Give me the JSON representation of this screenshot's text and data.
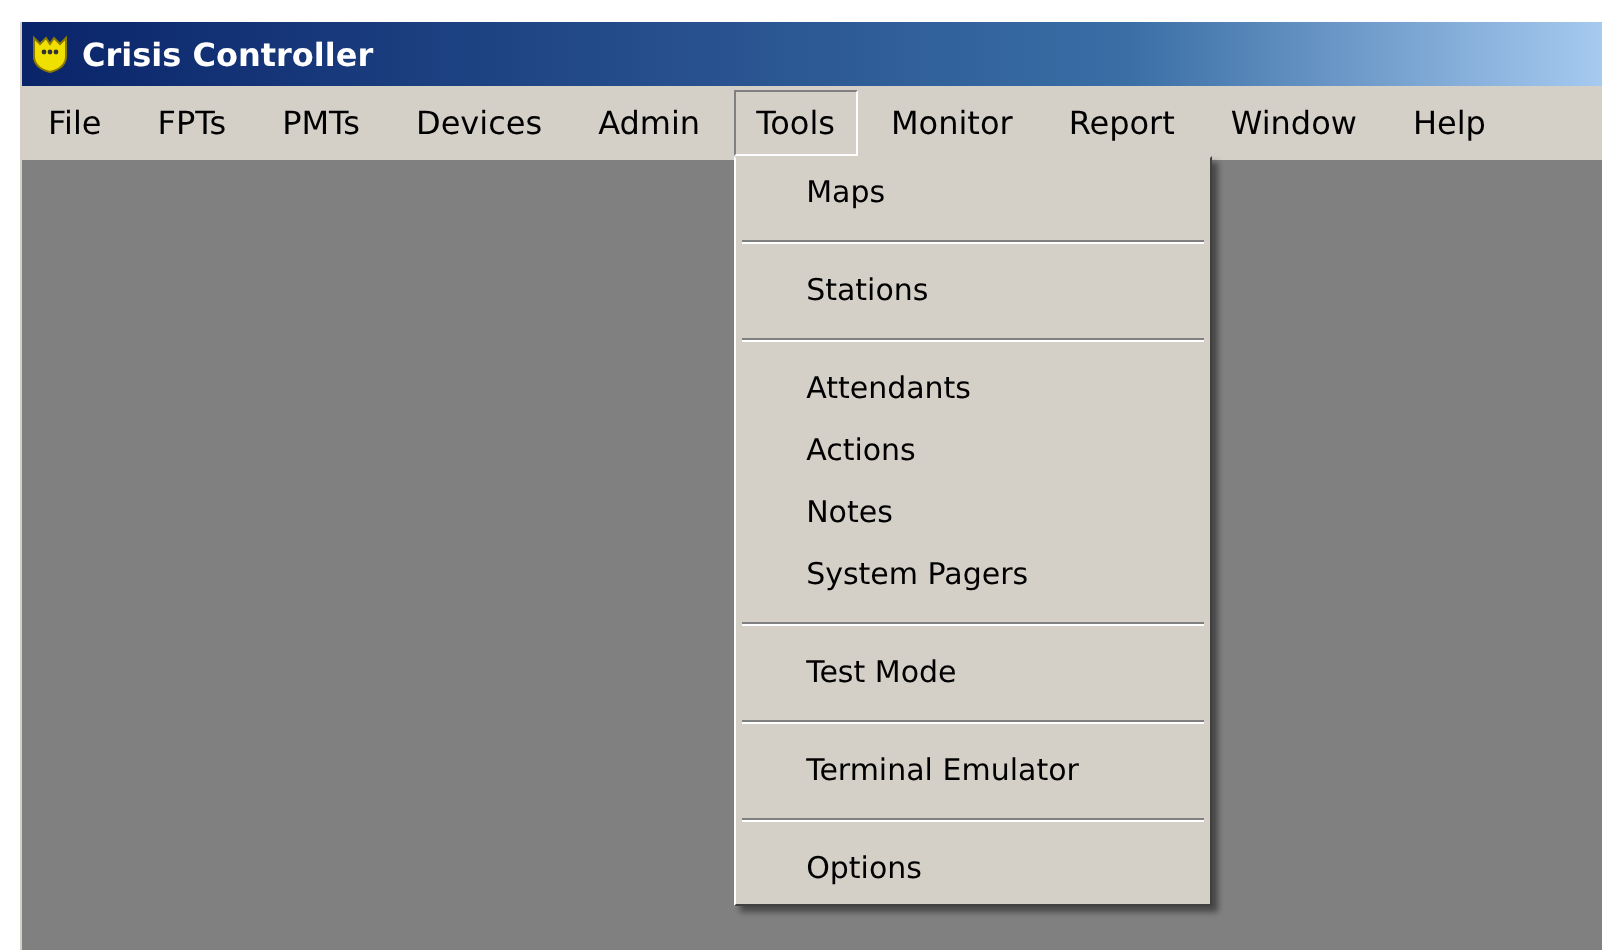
{
  "window": {
    "title": "Crisis Controller"
  },
  "menu_bar": [
    {
      "label": "File",
      "selected": false
    },
    {
      "label": "FPTs",
      "selected": false
    },
    {
      "label": "PMTs",
      "selected": false
    },
    {
      "label": "Devices",
      "selected": false
    },
    {
      "label": "Admin",
      "selected": false
    },
    {
      "label": "Tools",
      "selected": true
    },
    {
      "label": "Monitor",
      "selected": false
    },
    {
      "label": "Report",
      "selected": false
    },
    {
      "label": "Window",
      "selected": false
    },
    {
      "label": "Help",
      "selected": false
    }
  ],
  "dropdown": {
    "items": [
      {
        "kind": "item",
        "label": "Maps"
      },
      {
        "kind": "separator"
      },
      {
        "kind": "item",
        "label": "Stations"
      },
      {
        "kind": "separator"
      },
      {
        "kind": "item",
        "label": "Attendants"
      },
      {
        "kind": "item",
        "label": "Actions"
      },
      {
        "kind": "item",
        "label": "Notes"
      },
      {
        "kind": "item",
        "label": "System Pagers"
      },
      {
        "kind": "separator"
      },
      {
        "kind": "item",
        "label": "Test Mode"
      },
      {
        "kind": "separator"
      },
      {
        "kind": "item",
        "label": "Terminal Emulator"
      },
      {
        "kind": "separator"
      },
      {
        "kind": "item",
        "label": "Options"
      }
    ]
  }
}
